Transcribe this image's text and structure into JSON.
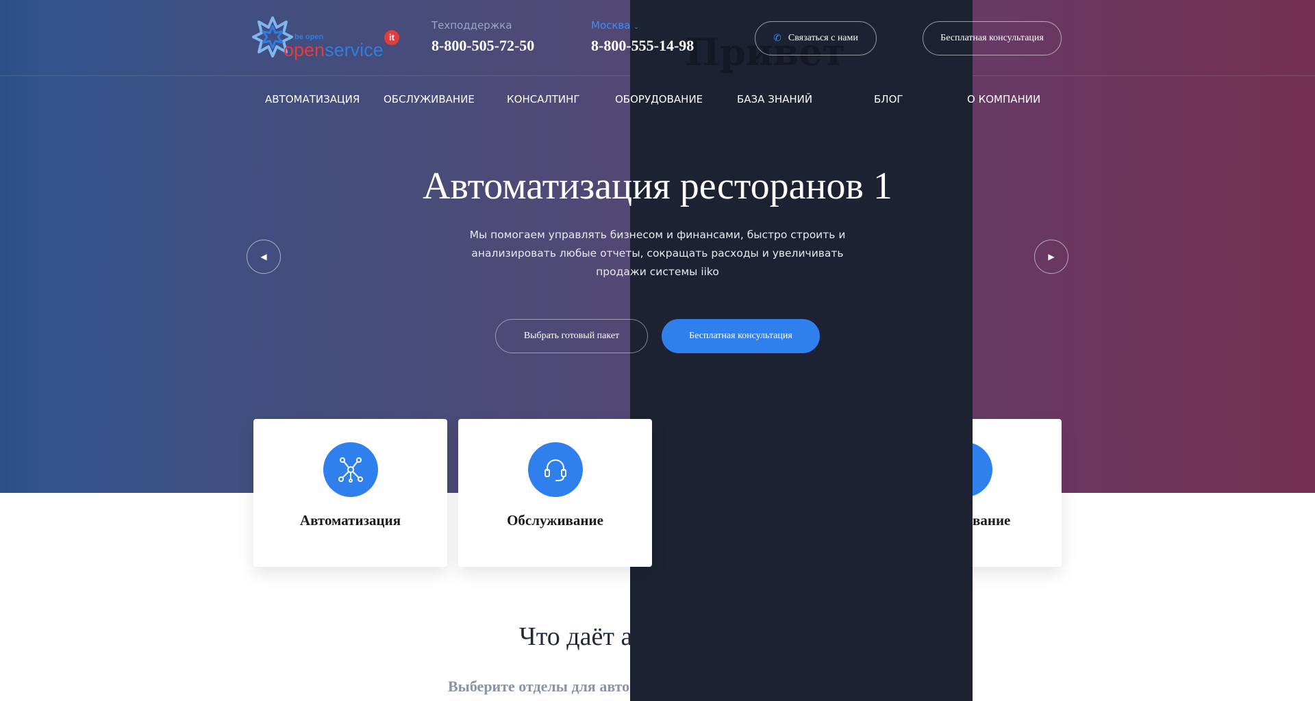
{
  "header": {
    "logo": {
      "tagline": "be open",
      "word_part1": "open",
      "word_part2": "service",
      "badge": "it"
    },
    "support": {
      "label": "Техподдержка",
      "phone": "8-800-505-72-50"
    },
    "city": {
      "label": "Москва",
      "phone": "8-800-555-14-98"
    },
    "contact_button": "Связаться с нами",
    "consult_button": "Бесплатная консультация",
    "ghost_text": "Привет"
  },
  "nav": {
    "items": [
      {
        "label": "АВТОМАТИЗАЦИЯ"
      },
      {
        "label": "ОБСЛУЖИВАНИЕ"
      },
      {
        "label": "КОНСАЛТИНГ"
      },
      {
        "label": "ОБОРУДОВАНИЕ"
      },
      {
        "label": "БАЗА ЗНАНИЙ"
      },
      {
        "label": "БЛОГ"
      },
      {
        "label": "О КОМПАНИИ"
      }
    ]
  },
  "hero": {
    "title": "Автоматизация ресторанов 1",
    "subtitle": "Мы помогаем управлять бизнесом и финансами, быстро строить и анализировать любые отчеты, сокращать расходы и увеличивать продажи системы iiko",
    "btn_package": "Выбрать готовый пакет",
    "btn_consult": "Бесплатная консультация"
  },
  "cards": [
    {
      "title": "Автоматизация",
      "icon": "network-icon"
    },
    {
      "title": "Обслуживание",
      "icon": "headset-icon"
    },
    {
      "title": "вание",
      "icon": "equipment-icon"
    }
  ],
  "section": {
    "title": "Что даёт а",
    "subtitle": "Выберите отделы для авто"
  },
  "colors": {
    "accent": "#2f80ed",
    "dark_panel": "#1d2232",
    "hero_left": "#2f5590",
    "hero_right": "#74304f"
  }
}
